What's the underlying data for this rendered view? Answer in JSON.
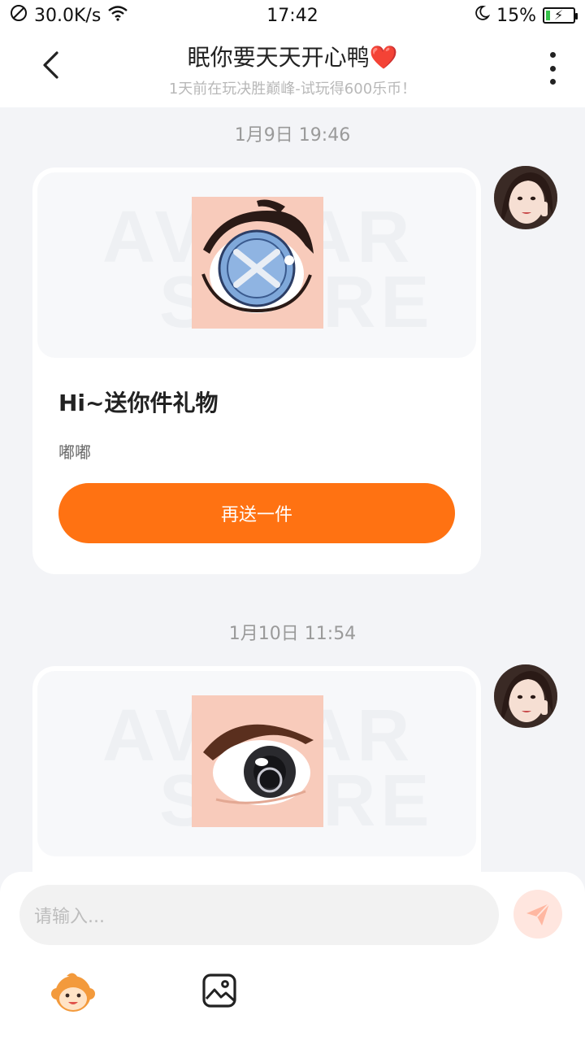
{
  "status_bar": {
    "network_speed": "30.0K/s",
    "time": "17:42",
    "battery_percent": "15%",
    "battery_level": 0.15
  },
  "header": {
    "title": "眠你要天天开心鸭❤️",
    "subtitle": "1天前在玩决胜巅峰-试玩得600乐币！"
  },
  "messages": [
    {
      "timestamp": "1月9日 19:46",
      "card_title": "Hi~送你件礼物",
      "card_subtitle": "嘟嘟",
      "button_label": "再送一件",
      "watermark": [
        "AVATAR",
        "STORE"
      ]
    },
    {
      "timestamp": "1月10日 11:54",
      "watermark": [
        "AVATAR",
        "STORE"
      ]
    }
  ],
  "input": {
    "placeholder": "请输入..."
  },
  "colors": {
    "accent": "#ff7212",
    "background": "#f3f4f7"
  }
}
